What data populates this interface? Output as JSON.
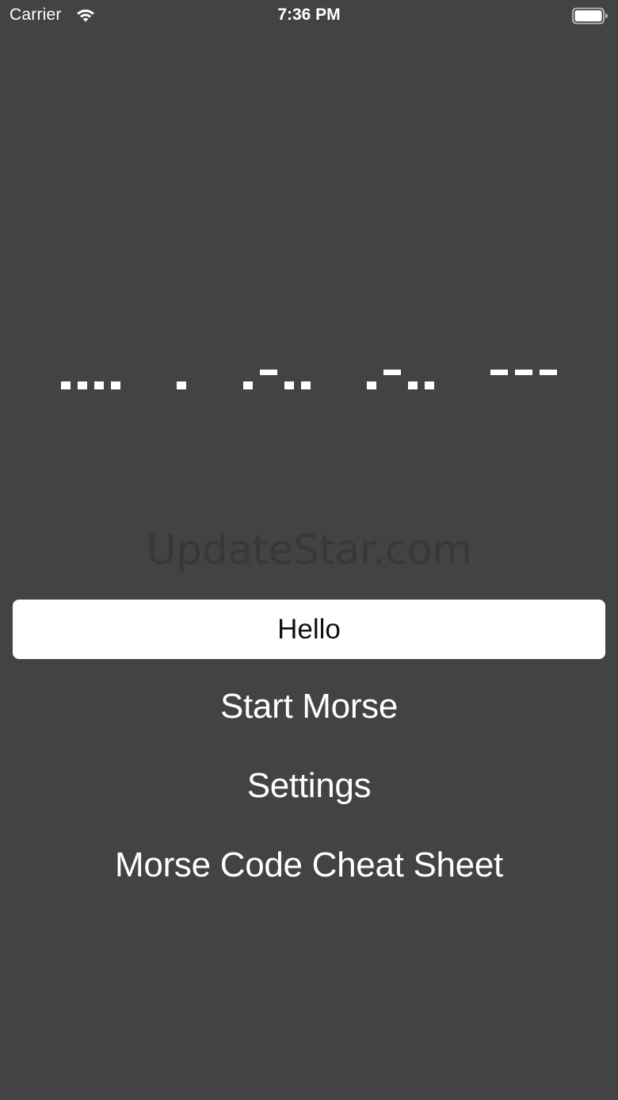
{
  "status_bar": {
    "carrier": "Carrier",
    "time": "7:36 PM",
    "wifi_icon": "wifi-icon",
    "battery_icon": "battery-icon"
  },
  "morse": {
    "word": ".... . .-.. .-.. ---",
    "letters": [
      {
        "letter": "H",
        "code": "...."
      },
      {
        "letter": "E",
        "code": "."
      },
      {
        "letter": "L",
        "code": ".-.."
      },
      {
        "letter": "L",
        "code": ".-.."
      },
      {
        "letter": "O",
        "code": "---"
      }
    ],
    "color": "#ffffff"
  },
  "watermark": "UpdateStar.com",
  "input": {
    "value": "Hello"
  },
  "menu": {
    "start_label": "Start Morse",
    "settings_label": "Settings",
    "cheat_sheet_label": "Morse Code Cheat Sheet"
  },
  "colors": {
    "background": "#434343",
    "input_background": "#ffffff",
    "text": "#ffffff"
  }
}
